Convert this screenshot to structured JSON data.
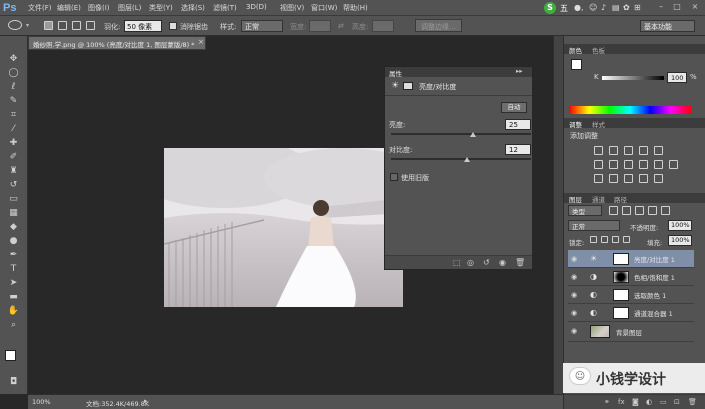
{
  "app": {
    "logo": "Ps",
    "menu": [
      "文件(F)",
      "编辑(E)",
      "图像(I)",
      "图层(L)",
      "类型(Y)",
      "选择(S)",
      "滤镜(T)",
      "3D(D)",
      "视图(V)",
      "窗口(W)",
      "帮助(H)"
    ],
    "window_controls": [
      "–",
      "□",
      "×"
    ]
  },
  "options_bar": {
    "feather_label": "羽化:",
    "feather_value": "50 像素",
    "antialias_label": "消除锯齿",
    "style_label": "样式:",
    "style_value": "正常",
    "width_label": "宽度:",
    "height_label": "高度:",
    "refine_edge_label": "调整边缘...",
    "workspace_value": "基本功能",
    "ime_indicator": "S",
    "ime_mode": "五"
  },
  "document": {
    "tab_title": "婚纱照.学.png @ 100% (亮度/对比度 1, 图层蒙版/8) *",
    "tab_close": "×",
    "zoom": "100%",
    "doc_info": "文档:352.4K/469.8K"
  },
  "properties_panel": {
    "title": "属性",
    "adjustment_name": "亮度/对比度",
    "auto_label": "自动",
    "brightness_label": "亮度:",
    "brightness_value": "25",
    "brightness_fraction": 0.583,
    "contrast_label": "对比度:",
    "contrast_value": "12",
    "contrast_fraction": 0.54,
    "use_legacy_label": "使用旧版"
  },
  "color_panel": {
    "tabs": [
      "颜色",
      "色板"
    ],
    "slider_label": "K",
    "slider_value": "100",
    "slider_unit": "%"
  },
  "adjustments_panel": {
    "tabs": [
      "调整",
      "样式"
    ],
    "title": "添加调整"
  },
  "layers_panel": {
    "tabs": [
      "图层",
      "通道",
      "路径"
    ],
    "filter_value": "类型",
    "blend_mode": "正常",
    "opacity_label": "不透明度:",
    "opacity_value": "100%",
    "lock_label": "锁定:",
    "fill_label": "填充:",
    "fill_value": "100%",
    "layers": [
      {
        "name": "亮度/对比度 1",
        "selected": true
      },
      {
        "name": "色相/饱和度 1",
        "selected": false
      },
      {
        "name": "选取颜色 1",
        "selected": false
      },
      {
        "name": "通道混合器 1",
        "selected": false
      },
      {
        "name": "背景图层",
        "selected": false
      }
    ]
  },
  "watermark": {
    "text": "小钱学设计"
  },
  "colors": {
    "accent": "#7fb9ef",
    "selected_layer": "#7f8fa8",
    "panel_bg": "#535353",
    "canvas_bg": "#282828"
  }
}
